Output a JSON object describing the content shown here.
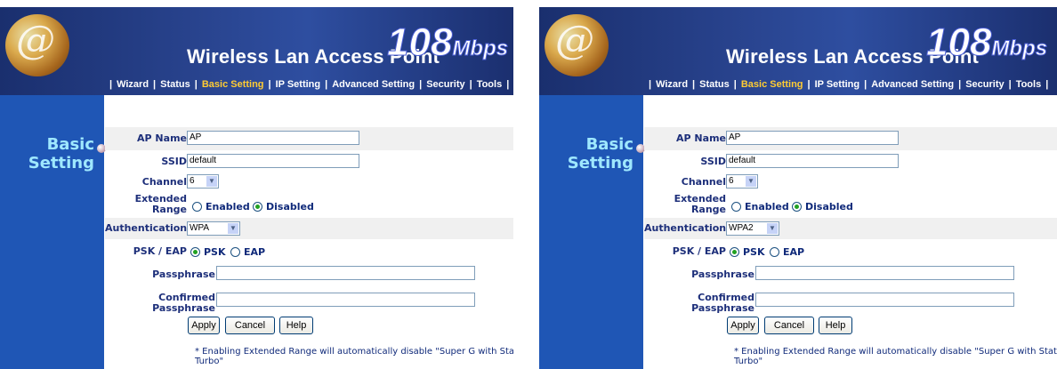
{
  "panels": [
    {
      "banner": {
        "title": "Wireless Lan Access Point",
        "speed_big": "108",
        "speed_small": "Mbps",
        "logo": "@"
      },
      "nav": [
        "Wizard",
        "Status",
        "Basic Setting",
        "IP Setting",
        "Advanced Setting",
        "Security",
        "Tools"
      ],
      "active_nav": "Basic Setting",
      "sidebar": {
        "title_line1": "Basic",
        "title_line2": "Setting"
      },
      "form": {
        "ap_name_label": "AP Name",
        "ap_name_value": "AP",
        "ssid_label": "SSID",
        "ssid_value": "default",
        "channel_label": "Channel",
        "channel_value": "6",
        "extended_label_1": "Extended",
        "extended_label_2": "Range",
        "enabled": "Enabled",
        "disabled": "Disabled",
        "extended_selected": "Disabled",
        "auth_label": "Authentication",
        "auth_value": "WPA",
        "psk_eap_label": "PSK / EAP",
        "psk": "PSK",
        "eap": "EAP",
        "psk_eap_selected": "PSK",
        "passphrase_label": "Passphrase",
        "passphrase_value": "",
        "confirmed_label_1": "Confirmed",
        "confirmed_label_2": "Passphrase",
        "confirmed_value": "",
        "apply": "Apply",
        "cancel": "Cancel",
        "help": "Help",
        "note_line1": "* Enabling Extended Range will automatically disable \"Super G with Static",
        "note_line2": "Turbo\""
      }
    },
    {
      "banner": {
        "title": "Wireless Lan Access Point",
        "speed_big": "108",
        "speed_small": "Mbps",
        "logo": "@"
      },
      "nav": [
        "Wizard",
        "Status",
        "Basic Setting",
        "IP Setting",
        "Advanced Setting",
        "Security",
        "Tools"
      ],
      "active_nav": "Basic Setting",
      "sidebar": {
        "title_line1": "Basic",
        "title_line2": "Setting"
      },
      "form": {
        "ap_name_label": "AP Name",
        "ap_name_value": "AP",
        "ssid_label": "SSID",
        "ssid_value": "default",
        "channel_label": "Channel",
        "channel_value": "6",
        "extended_label_1": "Extended",
        "extended_label_2": "Range",
        "enabled": "Enabled",
        "disabled": "Disabled",
        "extended_selected": "Disabled",
        "auth_label": "Authentication",
        "auth_value": "WPA2",
        "psk_eap_label": "PSK / EAP",
        "psk": "PSK",
        "eap": "EAP",
        "psk_eap_selected": "PSK",
        "passphrase_label": "Passphrase",
        "passphrase_value": "",
        "confirmed_label_1": "Confirmed",
        "confirmed_label_2": "Passphrase",
        "confirmed_value": "",
        "apply": "Apply",
        "cancel": "Cancel",
        "help": "Help",
        "note_line1": "* Enabling Extended Range will automatically disable \"Super G with Static",
        "note_line2": "Turbo\""
      }
    }
  ],
  "colors": {
    "banner": "#29448f",
    "sidebar": "#1f56b5",
    "sidebar_text": "#9fe8ff",
    "active_nav": "#ffcc33",
    "label": "#1d2f7a"
  },
  "icons": [
    "globe-logo-icon",
    "chevron-down-icon",
    "radio-icon",
    "sidebar-dot-icon"
  ]
}
